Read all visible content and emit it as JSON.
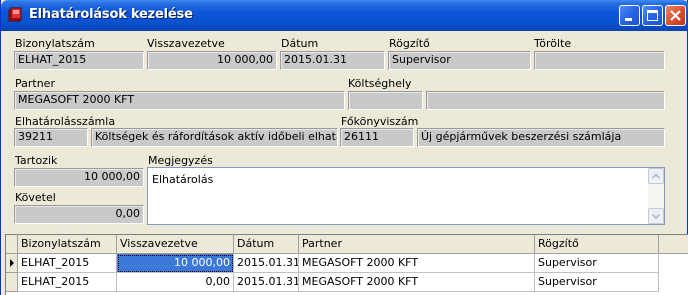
{
  "window": {
    "title": "Elhatárolások kezelése"
  },
  "labels": {
    "bizonylatszam": "Bizonylatszám",
    "visszavezetve": "Visszavezetve",
    "datum": "Dátum",
    "rogzito": "Rögzítő",
    "torolte": "Törölte",
    "partner": "Partner",
    "koltseghely": "Költséghely",
    "elhatarolasszamla": "Elhatárolásszámla",
    "fokonyviszam": "Főkönyviszám",
    "tartozik": "Tartozik",
    "megjegyzes": "Megjegyzés",
    "kovetel": "Követel"
  },
  "fields": {
    "bizonylatszam": "ELHAT_2015",
    "visszavezetve": "10 000,00",
    "datum": "2015.01.31",
    "rogzito": "Supervisor",
    "torolte": "",
    "partner": "MEGASOFT 2000 KFT",
    "koltseghely_code": "",
    "koltseghely_name": "",
    "elhatarolasszamla_code": "39211",
    "elhatarolasszamla_name": "Költségek és ráfordítások aktív időbeli elhatárolá",
    "fokonyviszam_code": "26111",
    "fokonyviszam_name": "Új gépjárművek beszerzési számlája",
    "tartozik": "10 000,00",
    "kovetel": "0,00",
    "megjegyzes": "Elhatárolás"
  },
  "grid": {
    "columns": [
      "Bizonylatszám",
      "Visszavezetve",
      "Dátum",
      "Partner",
      "Rögzítő"
    ],
    "rows": [
      [
        "ELHAT_2015",
        "10 000,00",
        "2015.01.31",
        "MEGASOFT 2000 KFT",
        "Supervisor"
      ],
      [
        "ELHAT_2015",
        "0,00",
        "2015.01.31",
        "MEGASOFT 2000 KFT",
        "Supervisor"
      ]
    ]
  },
  "colors": {
    "titlebar": "#0a56d8",
    "selection": "#3b78d8",
    "field_bg": "#c9c9c9",
    "window_bg": "#ece9d8"
  },
  "icons": [
    "app-book-icon",
    "minimize-icon",
    "maximize-icon",
    "close-icon",
    "row-pointer-icon",
    "scroll-up-icon",
    "scroll-down-icon"
  ]
}
